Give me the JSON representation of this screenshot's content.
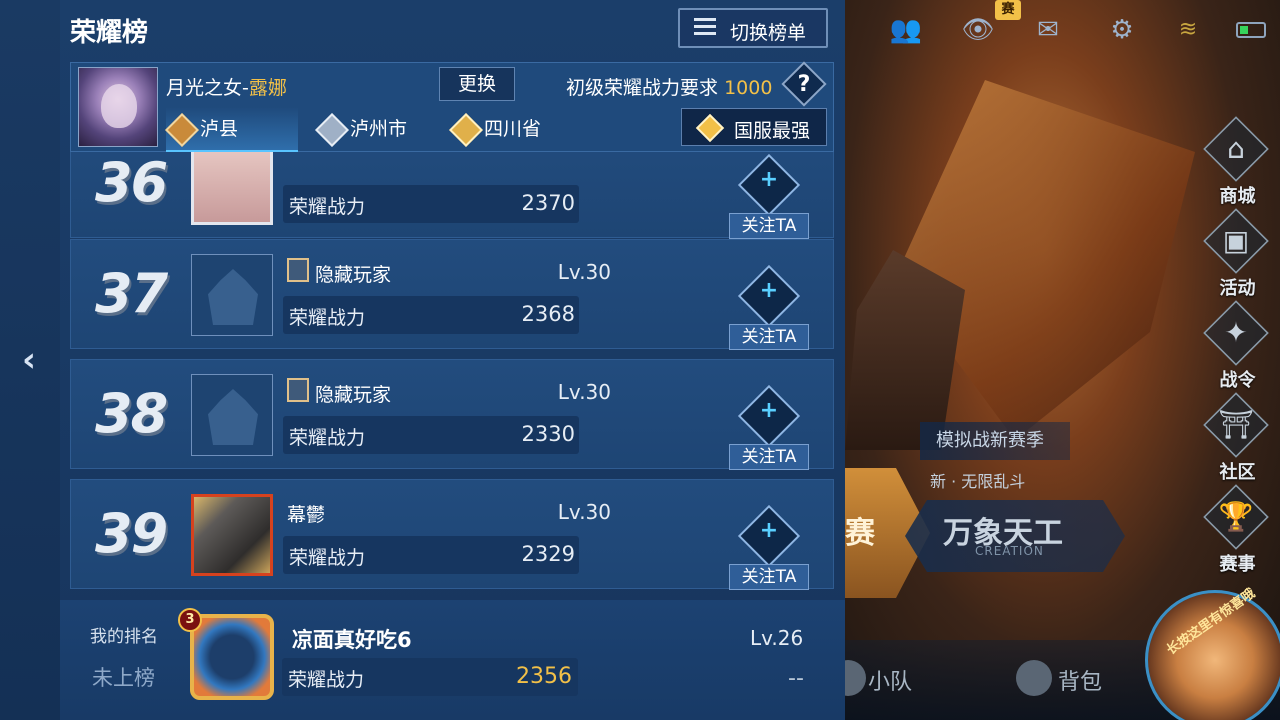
{
  "panel": {
    "title": "荣耀榜",
    "switch_label": "切换榜单"
  },
  "hero": {
    "name_prefix": "月光之女-",
    "name_hero": "露娜",
    "change_label": "更换",
    "requirement_label": "初级荣耀战力要求",
    "requirement_value": "1000",
    "help_label": "?"
  },
  "region_tabs": [
    {
      "label": "泸县",
      "active": true,
      "emblem_color": "#c98a3a"
    },
    {
      "label": "泸州市",
      "active": false,
      "emblem_color": "#b8c4d4"
    },
    {
      "label": "四川省",
      "active": false,
      "emblem_color": "#e0b04a"
    }
  ],
  "server_button": {
    "label": "国服最强"
  },
  "rows": [
    {
      "rank": "36",
      "name": "",
      "level": "",
      "power_label": "荣耀战力",
      "power": "2370",
      "follow": "关注TA",
      "avatar": "pink"
    },
    {
      "rank": "37",
      "name": "隐藏玩家",
      "level": "Lv.30",
      "power_label": "荣耀战力",
      "power": "2368",
      "follow": "关注TA",
      "avatar": "hidden"
    },
    {
      "rank": "38",
      "name": "隐藏玩家",
      "level": "Lv.30",
      "power_label": "荣耀战力",
      "power": "2330",
      "follow": "关注TA",
      "avatar": "hidden"
    },
    {
      "rank": "39",
      "name": "幕鬱",
      "level": "Lv.30",
      "power_label": "荣耀战力",
      "power": "2329",
      "follow": "关注TA",
      "avatar": "gold"
    }
  ],
  "my_rank": {
    "label": "我的排名",
    "status": "未上榜",
    "badge": "3",
    "name": "凉面真好吃6",
    "level": "Lv.26",
    "power_label": "荣耀战力",
    "power": "2356",
    "rank_dash": "--"
  },
  "side_menu": [
    {
      "label": "商城",
      "icon": "shop-icon"
    },
    {
      "label": "活动",
      "icon": "activity-icon"
    },
    {
      "label": "战令",
      "icon": "pass-icon"
    },
    {
      "label": "社区",
      "icon": "community-icon"
    },
    {
      "label": "赛事",
      "icon": "trophy-icon"
    }
  ],
  "top_bar": {
    "event_badge": "赛"
  },
  "game_modes": {
    "banner": "模拟战新赛季",
    "sub": "新 · 无限乱斗",
    "title": "万象天工",
    "title_en": "CREATION",
    "left_title": "赛"
  },
  "bottom_bar": {
    "team_label": "小队",
    "bag_label": "背包"
  },
  "corner_avatar": {
    "text": "长按这里有惊喜哦"
  },
  "colors": {
    "accent_gold": "#f2c048",
    "tab_active": "#59c4ff",
    "panel_bg": "#1b3e6a"
  }
}
